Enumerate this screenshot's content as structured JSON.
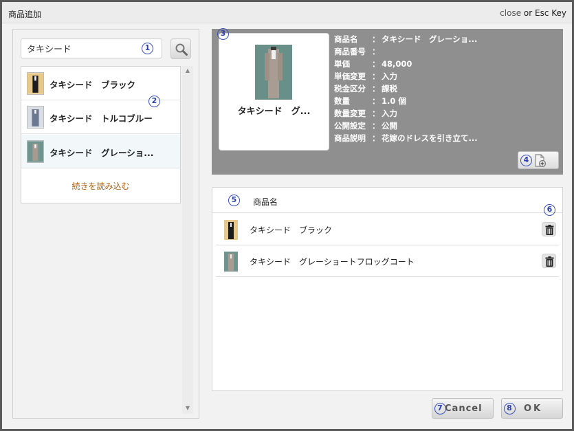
{
  "window": {
    "title": "商品追加",
    "close_link": "close",
    "close_or": " or Esc Key"
  },
  "markers": {
    "m1": "1",
    "m2": "2",
    "m3": "3",
    "m4": "4",
    "m5": "5",
    "m6": "6",
    "m7": "7",
    "m8": "8"
  },
  "search": {
    "value": "タキシード"
  },
  "product_list": {
    "items": [
      {
        "label": "タキシード　ブラック",
        "icon": "black-tuxedo-image"
      },
      {
        "label": "タキシード　トルコブルー",
        "icon": "blue-tuxedo-image"
      },
      {
        "label": "タキシード　グレーショ...",
        "icon": "grey-tuxedo-image",
        "selected": true
      }
    ],
    "load_more": "続きを読み込む"
  },
  "preview": {
    "card_label": "タキシード　グ...",
    "details": [
      {
        "key": "商品名",
        "sep": "：",
        "value": "タキシード　グレーショ..."
      },
      {
        "key": "商品番号",
        "sep": "：",
        "value": ""
      },
      {
        "key": "単価",
        "sep": "：",
        "value": "48,000"
      },
      {
        "key": "単価変更",
        "sep": "：",
        "value": "入力"
      },
      {
        "key": "税金区分",
        "sep": "：",
        "value": "課税"
      },
      {
        "key": "数量",
        "sep": "：",
        "value": "1.0 個"
      },
      {
        "key": "数量変更",
        "sep": "：",
        "value": "入力"
      },
      {
        "key": "公開設定",
        "sep": "：",
        "value": "公開"
      },
      {
        "key": "商品説明",
        "sep": "：",
        "value": "花嫁のドレスを引き立て..."
      }
    ]
  },
  "selected_table": {
    "column_header": "商品名",
    "rows": [
      {
        "name": "タキシード　ブラック",
        "icon": "black-tuxedo-image"
      },
      {
        "name": "タキシード　グレーショートフロッグコート",
        "icon": "grey-tuxedo-image"
      }
    ]
  },
  "footer": {
    "cancel_label": "Cancel",
    "ok_label": "OK"
  },
  "colors": {
    "accent_marker": "#3a4fc0",
    "load_more": "#b05d0c",
    "preview_bg": "#8f8f8f"
  }
}
